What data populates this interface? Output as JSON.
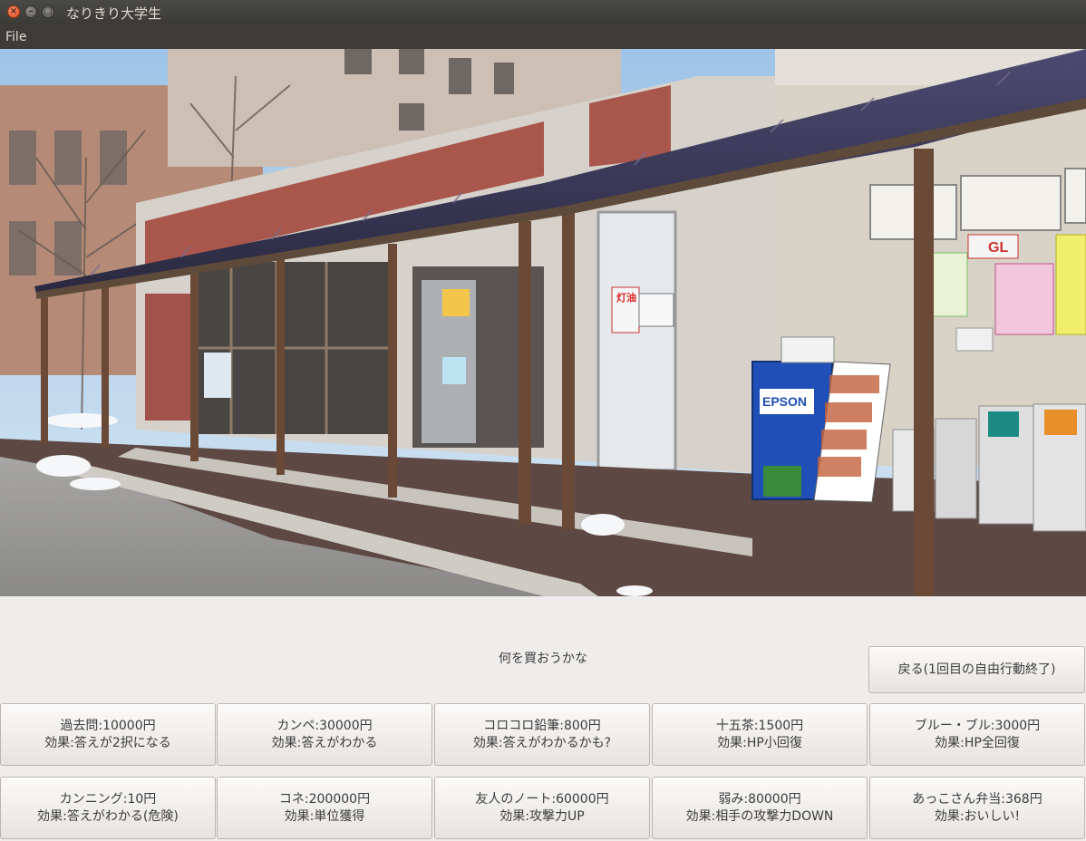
{
  "window": {
    "title": "なりきり大学生"
  },
  "menubar": {
    "file": "File"
  },
  "scene": {
    "prompt": "何を買おうかな"
  },
  "back_button": {
    "label": "戻る(1回目の自由行動終了)"
  },
  "photo": {
    "store_posters": [
      "灯油",
      "GL"
    ],
    "epson_box": "EPSON"
  },
  "items": [
    {
      "line1": "過去問:10000円",
      "line2": "効果:答えが2択になる"
    },
    {
      "line1": "カンペ:30000円",
      "line2": "効果:答えがわかる"
    },
    {
      "line1": "コロコロ鉛筆:800円",
      "line2": "効果:答えがわかるかも?"
    },
    {
      "line1": "十五茶:1500円",
      "line2": "効果:HP小回復"
    },
    {
      "line1": "ブルー・ブル:3000円",
      "line2": "効果:HP全回復"
    },
    {
      "line1": "カンニング:10円",
      "line2": "効果:答えがわかる(危険)"
    },
    {
      "line1": "コネ:200000円",
      "line2": "効果:単位獲得"
    },
    {
      "line1": "友人のノート:60000円",
      "line2": "効果:攻撃力UP"
    },
    {
      "line1": "弱み:80000円",
      "line2": "効果:相手の攻撃力DOWN"
    },
    {
      "line1": "あっこさん弁当:368円",
      "line2": "効果:おいしい!"
    }
  ]
}
